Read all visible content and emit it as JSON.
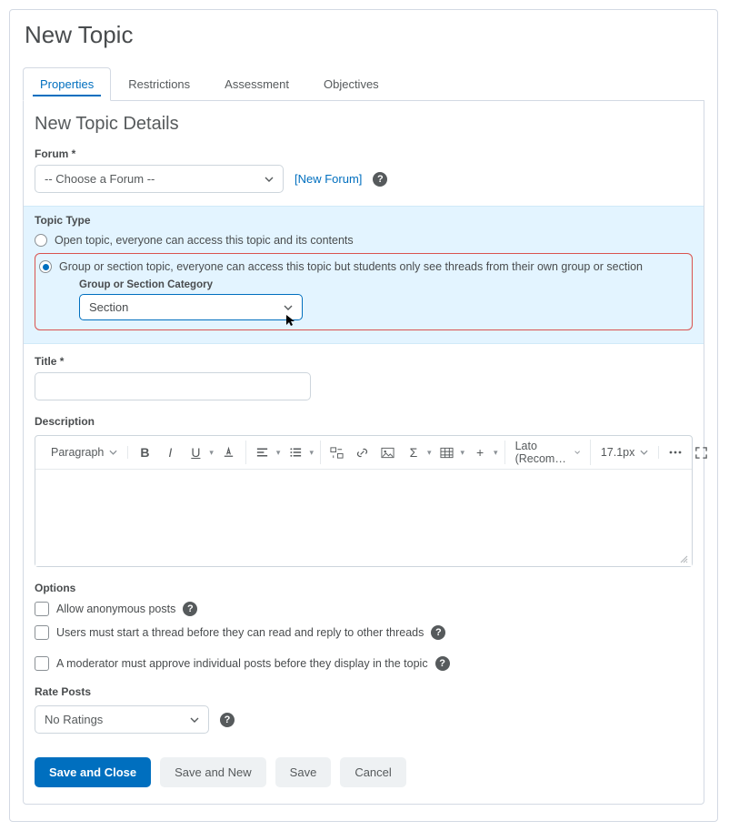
{
  "page": {
    "title": "New Topic"
  },
  "tabs": {
    "properties": "Properties",
    "restrictions": "Restrictions",
    "assessment": "Assessment",
    "objectives": "Objectives"
  },
  "details": {
    "title": "New Topic Details"
  },
  "forum": {
    "label": "Forum *",
    "placeholder": "-- Choose a Forum --",
    "new_link": "[New Forum]"
  },
  "topic_type": {
    "label": "Topic Type",
    "open": "Open topic, everyone can access this topic and its contents",
    "group": "Group or section topic, everyone can access this topic but students only see threads from their own group or section",
    "category_label": "Group or Section Category",
    "category_value": "Section"
  },
  "title": {
    "label": "Title *"
  },
  "description": {
    "label": "Description"
  },
  "toolbar": {
    "paragraph": "Paragraph",
    "font": "Lato (Recom…",
    "size": "17.1px"
  },
  "options": {
    "label": "Options",
    "anon": "Allow anonymous posts",
    "thread_first": "Users must start a thread before they can read and reply to other threads",
    "moderate": "A moderator must approve individual posts before they display in the topic"
  },
  "rate": {
    "label": "Rate Posts",
    "value": "No Ratings"
  },
  "buttons": {
    "save_close": "Save and Close",
    "save_new": "Save and New",
    "save": "Save",
    "cancel": "Cancel"
  }
}
